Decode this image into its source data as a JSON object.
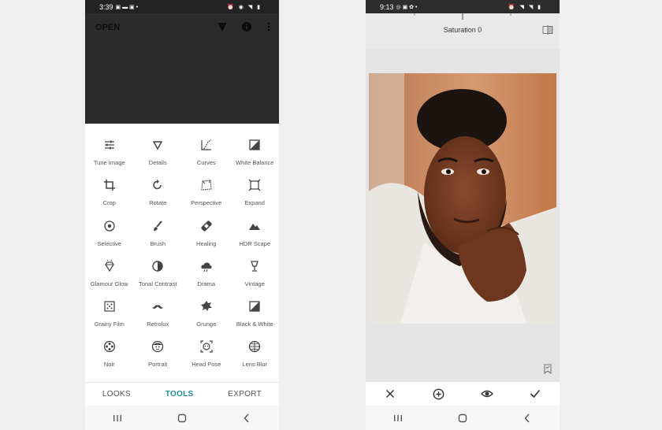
{
  "left_phone": {
    "status": {
      "time": "3:39"
    },
    "header": {
      "open_label": "OPEN",
      "icons": [
        "heal-history-icon",
        "info-icon",
        "more-vert-icon"
      ]
    },
    "tools": [
      {
        "name": "tune-image",
        "label": "Tune Image",
        "icon": "sliders-icon"
      },
      {
        "name": "details",
        "label": "Details",
        "icon": "triangle-down-icon"
      },
      {
        "name": "curves",
        "label": "Curves",
        "icon": "curves-icon"
      },
      {
        "name": "white-balance",
        "label": "White Balance",
        "icon": "white-balance-icon"
      },
      {
        "name": "crop",
        "label": "Crop",
        "icon": "crop-icon"
      },
      {
        "name": "rotate",
        "label": "Rotate",
        "icon": "rotate-icon"
      },
      {
        "name": "perspective",
        "label": "Perspective",
        "icon": "perspective-icon"
      },
      {
        "name": "expand",
        "label": "Expand",
        "icon": "expand-icon"
      },
      {
        "name": "selective",
        "label": "Selective",
        "icon": "target-icon"
      },
      {
        "name": "brush",
        "label": "Brush",
        "icon": "brush-icon"
      },
      {
        "name": "healing",
        "label": "Healing",
        "icon": "bandage-icon"
      },
      {
        "name": "hdr-scape",
        "label": "HDR Scape",
        "icon": "mountain-icon"
      },
      {
        "name": "glamour-glow",
        "label": "Glamour Glow",
        "icon": "diamond-icon"
      },
      {
        "name": "tonal-contrast",
        "label": "Tonal Contrast",
        "icon": "half-circle-icon"
      },
      {
        "name": "drama",
        "label": "Drama",
        "icon": "cloud-icon"
      },
      {
        "name": "vintage",
        "label": "Vintage",
        "icon": "lamp-icon"
      },
      {
        "name": "grainy-film",
        "label": "Grainy Film",
        "icon": "grain-icon"
      },
      {
        "name": "retrolux",
        "label": "Retrolux",
        "icon": "mustache-icon"
      },
      {
        "name": "grunge",
        "label": "Grunge",
        "icon": "grunge-icon"
      },
      {
        "name": "black-white",
        "label": "Black & White",
        "icon": "black-white-icon"
      },
      {
        "name": "noir",
        "label": "Noir",
        "icon": "film-reel-icon"
      },
      {
        "name": "portrait",
        "label": "Portrait",
        "icon": "face-icon"
      },
      {
        "name": "head-pose",
        "label": "Head Pose",
        "icon": "head-pose-icon"
      },
      {
        "name": "lens-blur",
        "label": "Lens Blur",
        "icon": "lens-blur-icon"
      }
    ],
    "tabs": [
      {
        "label": "LOOKS",
        "active": false
      },
      {
        "label": "TOOLS",
        "active": true
      },
      {
        "label": "EXPORT",
        "active": false
      }
    ],
    "accent_color": "#1e8e99"
  },
  "right_phone": {
    "status": {
      "time": "9:13"
    },
    "adjustment": {
      "label": "Saturation 0"
    },
    "actions": [
      "close-icon",
      "add-circle-icon",
      "eye-icon",
      "check-icon"
    ]
  }
}
